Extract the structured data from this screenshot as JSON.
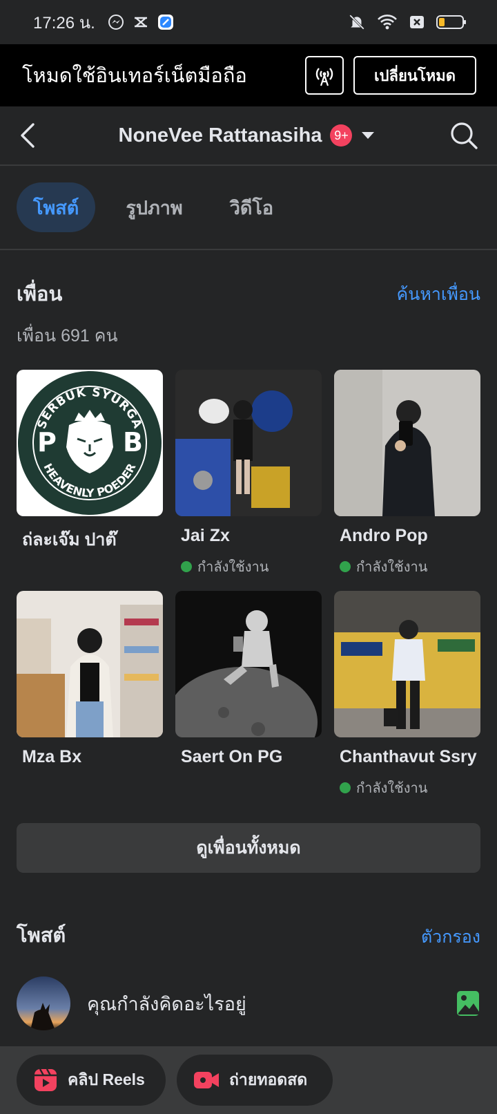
{
  "status_bar": {
    "time": "17:26 น."
  },
  "mode_bar": {
    "text": "โหมดใช้อินเทอร์เน็ตมือถือ",
    "switch_label": "เปลี่ยนโหมด"
  },
  "nav": {
    "title": "NoneVee Rattanasiha",
    "badge": "9+"
  },
  "tabs": [
    {
      "label": "โพสต์",
      "active": true
    },
    {
      "label": "รูปภาพ",
      "active": false
    },
    {
      "label": "วิดีโอ",
      "active": false
    }
  ],
  "friends": {
    "heading": "เพื่อน",
    "find_link": "ค้นหาเพื่อน",
    "count": "เพื่อน 691 คน",
    "items": [
      {
        "name": "ถ่ละเจ๊ม ปาต๊",
        "online": ""
      },
      {
        "name": "Jai Zx",
        "online": "กำลังใช้งาน"
      },
      {
        "name": "Andro Pop",
        "online": "กำลังใช้งาน"
      },
      {
        "name": "Mza Bx",
        "online": ""
      },
      {
        "name": "Saert On PG",
        "online": ""
      },
      {
        "name": "Chanthavut Ssry",
        "online": "กำลังใช้งาน"
      }
    ],
    "see_all": "ดูเพื่อนทั้งหมด"
  },
  "logo": {
    "top_text": "SERBUK SYURGA",
    "bottom_text": "HEAVENLY POEDER",
    "left_letter": "P",
    "right_letter": "B"
  },
  "posts": {
    "heading": "โพสต์",
    "filter_link": "ตัวกรอง",
    "composer_prompt": "คุณกำลังคิดอะไรอยู่"
  },
  "quick_actions": {
    "reels_label": "คลิป Reels",
    "live_label": "ถ่ายทอดสด"
  },
  "colors": {
    "accent": "#4599ff",
    "online": "#31a24c",
    "badge": "#f3425f",
    "reels": "#f3425f"
  }
}
